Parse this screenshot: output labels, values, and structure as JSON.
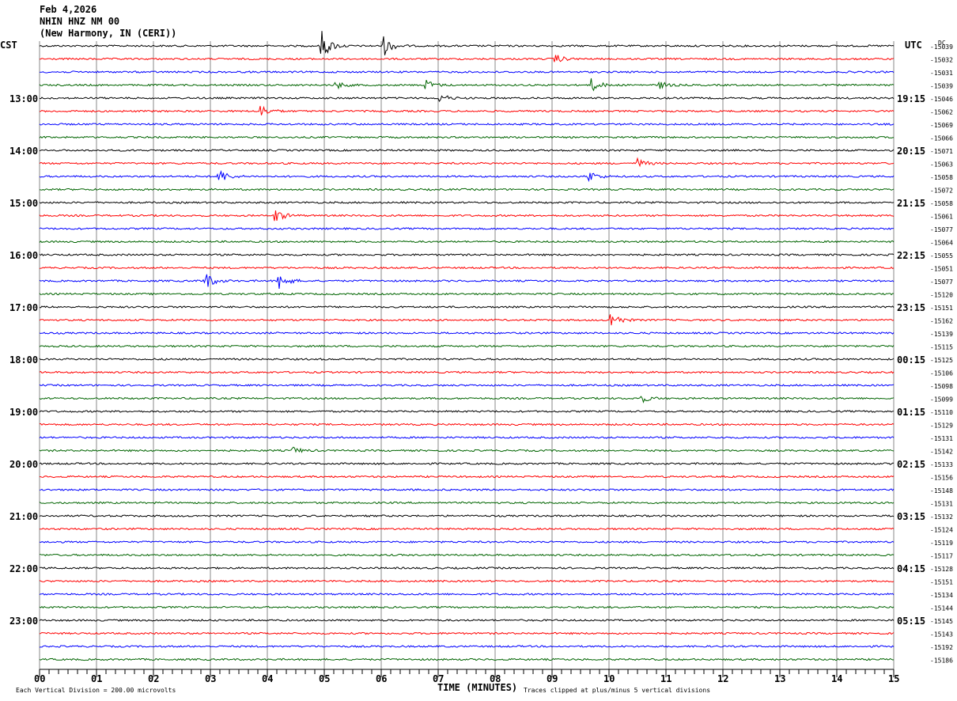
{
  "header": {
    "date": "Feb 4,2026",
    "station": "NHIN HNZ NM 00",
    "location": "(New Harmony, IN (CERI))",
    "left_tz": "CST",
    "right_tz": "UTC",
    "dc_label": "DC"
  },
  "chart_data": {
    "type": "line",
    "subtype": "helicorder",
    "xlabel": "TIME (MINUTES)",
    "xlim": [
      0,
      15
    ],
    "x_ticks": [
      "00",
      "01",
      "02",
      "03",
      "04",
      "05",
      "06",
      "07",
      "08",
      "09",
      "10",
      "11",
      "12",
      "13",
      "14",
      "15"
    ],
    "rows": 48,
    "row_minutes": 15,
    "colors": [
      "#000000",
      "#ff0000",
      "#0000ff",
      "#006400"
    ],
    "left_labels": [
      {
        "row": 4,
        "text": "13:00"
      },
      {
        "row": 8,
        "text": "14:00"
      },
      {
        "row": 12,
        "text": "15:00"
      },
      {
        "row": 16,
        "text": "16:00"
      },
      {
        "row": 20,
        "text": "17:00"
      },
      {
        "row": 24,
        "text": "18:00"
      },
      {
        "row": 28,
        "text": "19:00"
      },
      {
        "row": 32,
        "text": "20:00"
      },
      {
        "row": 36,
        "text": "21:00"
      },
      {
        "row": 40,
        "text": "22:00"
      },
      {
        "row": 44,
        "text": "23:00"
      }
    ],
    "right_labels": [
      {
        "row": 4,
        "text": "19:15"
      },
      {
        "row": 8,
        "text": "20:15"
      },
      {
        "row": 12,
        "text": "21:15"
      },
      {
        "row": 16,
        "text": "22:15"
      },
      {
        "row": 20,
        "text": "23:15"
      },
      {
        "row": 24,
        "text": "00:15"
      },
      {
        "row": 28,
        "text": "01:15"
      },
      {
        "row": 32,
        "text": "02:15"
      },
      {
        "row": 36,
        "text": "03:15"
      },
      {
        "row": 40,
        "text": "04:15"
      },
      {
        "row": 44,
        "text": "05:15"
      }
    ],
    "dc_offsets": [
      "-15039",
      "-15032",
      "-15031",
      "-15039",
      "-15046",
      "-15062",
      "-15069",
      "-15066",
      "-15071",
      "-15063",
      "-15058",
      "-15072",
      "-15058",
      "-15061",
      "-15077",
      "-15064",
      "-15055",
      "-15051",
      "-15077",
      "-15120",
      "-15151",
      "-15162",
      "-15139",
      "-15115",
      "-15125",
      "-15106",
      "-15098",
      "-15099",
      "-15110",
      "-15129",
      "-15131",
      "-15142",
      "-15133",
      "-15156",
      "-15148",
      "-15131",
      "-15132",
      "-15124",
      "-15119",
      "-15117",
      "-15128",
      "-15151",
      "-15134",
      "-15144",
      "-15145",
      "-15143",
      "-15192",
      "-15186"
    ],
    "events": [
      {
        "row": 0,
        "minute": 4.95,
        "amp": 5
      },
      {
        "row": 0,
        "minute": 6.05,
        "amp": 3
      },
      {
        "row": 1,
        "minute": 9.05,
        "amp": 1.5
      },
      {
        "row": 3,
        "minute": 5.2,
        "amp": 1.2
      },
      {
        "row": 3,
        "minute": 6.8,
        "amp": 1.5
      },
      {
        "row": 3,
        "minute": 9.7,
        "amp": 2
      },
      {
        "row": 3,
        "minute": 10.9,
        "amp": 1
      },
      {
        "row": 4,
        "minute": 7.05,
        "amp": 1.2
      },
      {
        "row": 5,
        "minute": 3.9,
        "amp": 1.8
      },
      {
        "row": 9,
        "minute": 10.5,
        "amp": 1.5
      },
      {
        "row": 10,
        "minute": 3.15,
        "amp": 2.5
      },
      {
        "row": 10,
        "minute": 9.65,
        "amp": 1.8
      },
      {
        "row": 13,
        "minute": 4.15,
        "amp": 2
      },
      {
        "row": 18,
        "minute": 4.2,
        "amp": 3
      },
      {
        "row": 18,
        "minute": 2.9,
        "amp": 3
      },
      {
        "row": 21,
        "minute": 10.05,
        "amp": 2.5
      },
      {
        "row": 27,
        "minute": 10.55,
        "amp": 1.5
      },
      {
        "row": 31,
        "minute": 4.45,
        "amp": 1
      }
    ],
    "footer_left": "Each Vertical Division =  200.00 microvolts",
    "footer_right": "Traces clipped at plus/minus 5 vertical divisions"
  }
}
